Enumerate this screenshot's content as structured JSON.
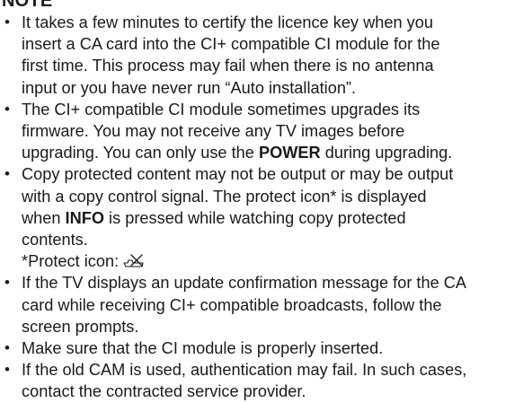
{
  "heading": "NOTE",
  "items": [
    {
      "lines": [
        "It takes a few minutes to certify the licence key when you",
        "insert a CA card into the CI+ compatible CI module for the",
        "first time. This process may fail when there is no antenna",
        "input or you have never run “Auto installation”."
      ]
    },
    {
      "lines": [
        "The CI+ compatible CI module sometimes upgrades its",
        "firmware. You may not receive any TV images before"
      ],
      "last_line_pre": "upgrading. You can only use the ",
      "last_line_bold": "POWER",
      "last_line_post": " during upgrading."
    },
    {
      "line1": "Copy protected content may not be output or may be output",
      "line2": "with a copy control signal. The protect icon* is displayed",
      "line3_pre": "when ",
      "line3_bold": "INFO",
      "line3_post": " is pressed while watching copy protected",
      "line4": "contents.",
      "protect_label": "*Protect icon: "
    },
    {
      "lines": [
        "If the TV displays an update confirmation message for the CA",
        "card while receiving CI+ compatible broadcasts, follow the",
        "screen prompts."
      ]
    },
    {
      "lines": [
        "Make sure that the CI module is properly inserted."
      ]
    },
    {
      "lines": [
        "If the old CAM is used, authentication may fail. In such cases,",
        "contact the contracted service provider."
      ]
    }
  ],
  "icons": {
    "bullet": "•",
    "protect": "protect-icon"
  }
}
